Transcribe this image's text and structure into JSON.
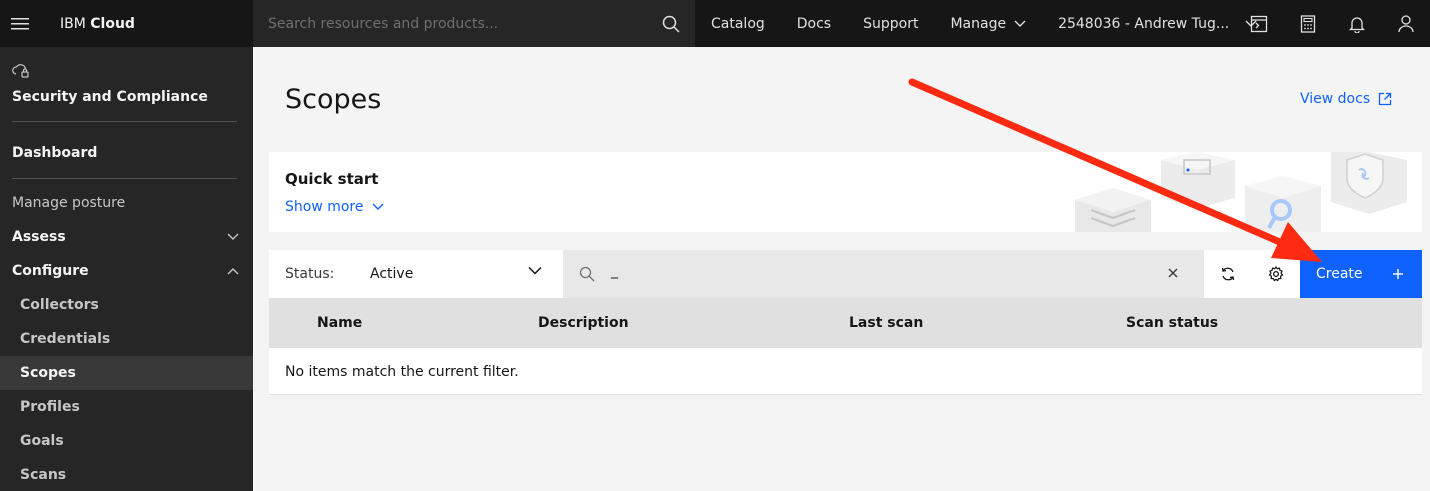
{
  "header": {
    "brand_prefix": "IBM",
    "brand_bold": "Cloud",
    "search_placeholder": "Search resources and products...",
    "nav": [
      "Catalog",
      "Docs",
      "Support",
      "Manage"
    ],
    "account": "2548036 - Andrew Tug..."
  },
  "sidebar": {
    "title": "Security and Compliance",
    "dashboard": "Dashboard",
    "manage_posture": "Manage posture",
    "assess": "Assess",
    "configure": "Configure",
    "configure_items": [
      "Collectors",
      "Credentials",
      "Scopes",
      "Profiles",
      "Goals",
      "Scans"
    ],
    "active_item": "Scopes"
  },
  "main": {
    "title": "Scopes",
    "view_docs": "View docs",
    "quickstart": {
      "title": "Quick start",
      "show_more": "Show more"
    },
    "toolbar": {
      "status_label": "Status:",
      "status_value": "Active",
      "filter_value": "_",
      "create_label": "Create"
    },
    "table": {
      "columns": [
        "Name",
        "Description",
        "Last scan",
        "Scan status"
      ],
      "empty_message": "No items match the current filter."
    }
  },
  "colors": {
    "accent": "#0f62fe",
    "header_bg": "#161616",
    "sidebar_bg": "#262626",
    "annotation_arrow": "#ff2a12"
  },
  "icons": [
    "hamburger-icon",
    "search-icon",
    "chevron-down-icon",
    "terminal-icon",
    "calculator-icon",
    "notification-icon",
    "user-icon",
    "cloud-security-icon",
    "chevron-up-icon",
    "launch-icon",
    "close-icon",
    "refresh-icon",
    "settings-icon",
    "add-icon"
  ]
}
